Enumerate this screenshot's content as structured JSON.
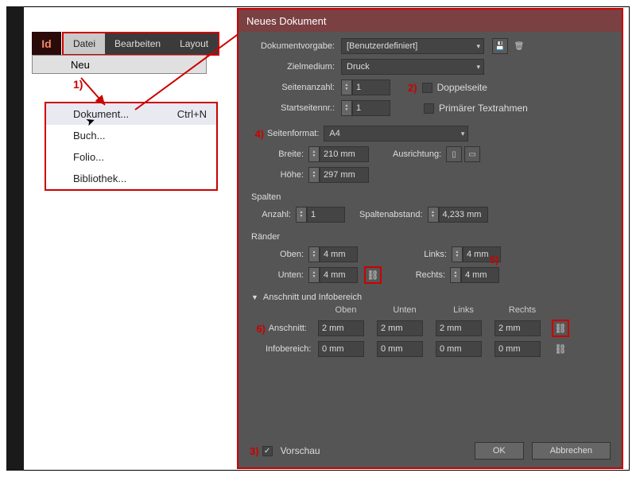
{
  "app": {
    "badge": "Id"
  },
  "menubar": {
    "items": [
      "Datei",
      "Bearbeiten",
      "Layout"
    ]
  },
  "neu_flyout": "Neu",
  "submenu": {
    "items": [
      {
        "label": "Dokument...",
        "shortcut": "Ctrl+N"
      },
      {
        "label": "Buch..."
      },
      {
        "label": "Folio..."
      },
      {
        "label": "Bibliothek..."
      }
    ]
  },
  "annotations": {
    "a1": "1)",
    "a2": "2)",
    "a3": "3)",
    "a4": "4)",
    "a5": "5)",
    "a6": "6)"
  },
  "dialog": {
    "title": "Neues Dokument",
    "preset": {
      "label": "Dokumentvorgabe:",
      "value": "[Benutzerdefiniert]"
    },
    "intent": {
      "label": "Zielmedium:",
      "value": "Druck"
    },
    "pages": {
      "label": "Seitenanzahl:",
      "value": "1"
    },
    "start": {
      "label": "Startseitennr.:",
      "value": "1"
    },
    "facing": {
      "label": "Doppelseite",
      "checked": false
    },
    "primary": {
      "label": "Primärer Textrahmen",
      "checked": false
    },
    "pagesize": {
      "label": "Seitenformat:",
      "value": "A4"
    },
    "width": {
      "label": "Breite:",
      "value": "210 mm"
    },
    "height": {
      "label": "Höhe:",
      "value": "297 mm"
    },
    "orientation_label": "Ausrichtung:",
    "columns": {
      "header": "Spalten",
      "count": {
        "label": "Anzahl:",
        "value": "1"
      },
      "gutter": {
        "label": "Spaltenabstand:",
        "value": "4,233 mm"
      }
    },
    "margins": {
      "header": "Ränder",
      "top": {
        "label": "Oben:",
        "value": "4 mm"
      },
      "bottom": {
        "label": "Unten:",
        "value": "4 mm"
      },
      "left": {
        "label": "Links:",
        "value": "4 mm"
      },
      "right": {
        "label": "Rechts:",
        "value": "4 mm"
      }
    },
    "bleed": {
      "header": "Anschnitt und Infobereich",
      "cols": [
        "Oben",
        "Unten",
        "Links",
        "Rechts"
      ],
      "rows": [
        {
          "label": "Anschnitt:",
          "values": [
            "2 mm",
            "2 mm",
            "2 mm",
            "2 mm"
          ]
        },
        {
          "label": "Infobereich:",
          "values": [
            "0 mm",
            "0 mm",
            "0 mm",
            "0 mm"
          ]
        }
      ]
    },
    "preview": {
      "label": "Vorschau",
      "checked": true
    },
    "ok": "OK",
    "cancel": "Abbrechen"
  }
}
